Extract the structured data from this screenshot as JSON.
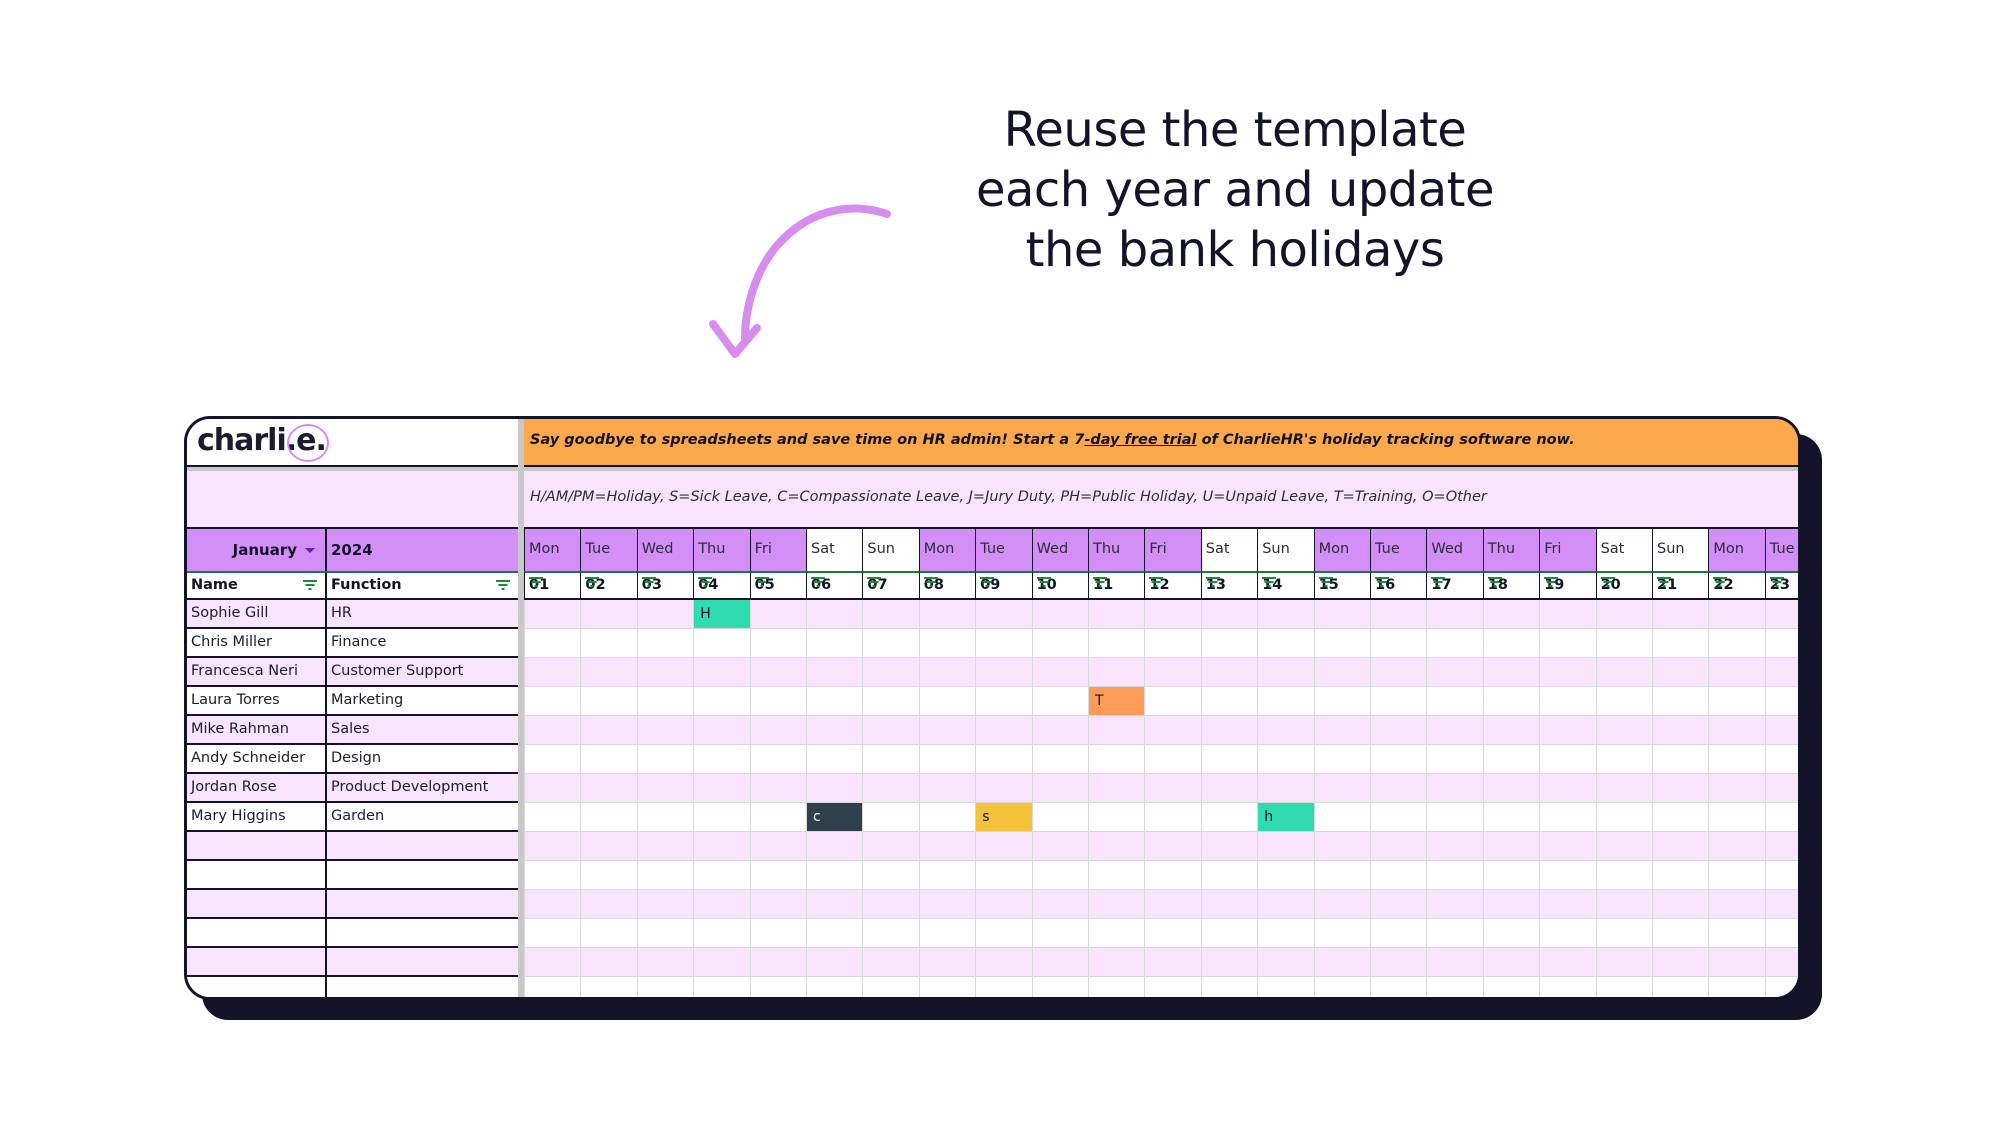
{
  "headline": [
    "Reuse the template",
    "each year and update",
    "the bank holidays"
  ],
  "logo": {
    "text": "charli.e."
  },
  "banner": {
    "prefix": "Say goodbye to spreadsheets and save time on HR admin! Start a 7",
    "link": "-day free trial",
    "suffix": " of CharlieHR's holiday tracking software now."
  },
  "legend": "H/AM/PM=Holiday, S=Sick Leave, C=Compassionate Leave, J=Jury Duty, PH=Public Holiday, U=Unpaid Leave, T=Training, O=Other",
  "period": {
    "month": "January",
    "year": "2024"
  },
  "columns": {
    "name": "Name",
    "function": "Function"
  },
  "days": [
    {
      "name": "Mon",
      "num": "01"
    },
    {
      "name": "Tue",
      "num": "02"
    },
    {
      "name": "Wed",
      "num": "03"
    },
    {
      "name": "Thu",
      "num": "04"
    },
    {
      "name": "Fri",
      "num": "05"
    },
    {
      "name": "Sat",
      "num": "06"
    },
    {
      "name": "Sun",
      "num": "07"
    },
    {
      "name": "Mon",
      "num": "08"
    },
    {
      "name": "Tue",
      "num": "09"
    },
    {
      "name": "Wed",
      "num": "10"
    },
    {
      "name": "Thu",
      "num": "11"
    },
    {
      "name": "Fri",
      "num": "12"
    },
    {
      "name": "Sat",
      "num": "13"
    },
    {
      "name": "Sun",
      "num": "14"
    },
    {
      "name": "Mon",
      "num": "15"
    },
    {
      "name": "Tue",
      "num": "16"
    },
    {
      "name": "Wed",
      "num": "17"
    },
    {
      "name": "Thu",
      "num": "18"
    },
    {
      "name": "Fri",
      "num": "19"
    },
    {
      "name": "Sat",
      "num": "20"
    },
    {
      "name": "Sun",
      "num": "21"
    },
    {
      "name": "Mon",
      "num": "22"
    },
    {
      "name": "Tue",
      "num": "23"
    }
  ],
  "employees": [
    {
      "name": "Sophie Gill",
      "function": "HR"
    },
    {
      "name": "Chris Miller",
      "function": "Finance"
    },
    {
      "name": "Francesca Neri",
      "function": "Customer Support"
    },
    {
      "name": "Laura Torres",
      "function": "Marketing"
    },
    {
      "name": "Mike Rahman",
      "function": "Sales"
    },
    {
      "name": "Andy Schneider",
      "function": "Design"
    },
    {
      "name": "Jordan Rose",
      "function": "Product Development"
    },
    {
      "name": "Mary Higgins",
      "function": "Garden"
    },
    {
      "name": "",
      "function": ""
    },
    {
      "name": "",
      "function": ""
    },
    {
      "name": "",
      "function": ""
    },
    {
      "name": "",
      "function": ""
    },
    {
      "name": "",
      "function": ""
    },
    {
      "name": "",
      "function": ""
    }
  ],
  "entries": [
    {
      "row": 0,
      "day": "04",
      "code": "H",
      "type": "holiday"
    },
    {
      "row": 3,
      "day": "11",
      "code": "T",
      "type": "training"
    },
    {
      "row": 7,
      "day": "06",
      "code": "c",
      "type": "compassionate"
    },
    {
      "row": 7,
      "day": "09",
      "code": "s",
      "type": "sick"
    },
    {
      "row": 7,
      "day": "14",
      "code": "h",
      "type": "holiday"
    }
  ],
  "colors": {
    "holiday": "#2fdcb0",
    "training": "#fd9c57",
    "compassionate": "#2f3f4b",
    "sick": "#f5c33b",
    "weekday_header": "#d38ff7",
    "weekend_header": "#ffffff",
    "row_alt": "#f9e4fd",
    "banner": "#fca84d",
    "arrow": "#d88cf0"
  }
}
